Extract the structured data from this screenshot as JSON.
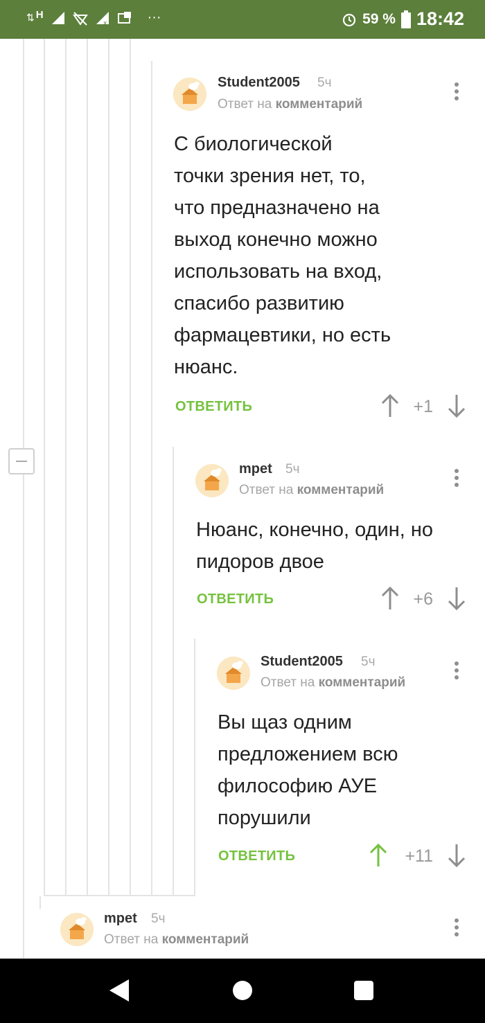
{
  "status_bar": {
    "network": "H",
    "battery_percent": "59 %",
    "time": "18:42",
    "more": "···"
  },
  "comments": [
    {
      "author": "Student2005",
      "time": "5ч",
      "reply_prefix": "Ответ на",
      "reply_link": "комментарий",
      "lines": [
        "С биологической",
        "точки зрения нет, то,",
        "что предназначено на",
        "выход конечно можно",
        "использовать на вход,",
        "спасибо развитию",
        "фармацевтики, но есть",
        "нюанс."
      ],
      "reply_label": "ОТВЕТИТЬ",
      "score": "+1",
      "upvoted": false
    },
    {
      "author": "mpet",
      "time": "5ч",
      "reply_prefix": "Ответ на",
      "reply_link": "комментарий",
      "lines": [
        "Нюанс, конечно, один, но",
        "пидоров двое"
      ],
      "reply_label": "ОТВЕТИТЬ",
      "score": "+6",
      "upvoted": false
    },
    {
      "author": "Student2005",
      "time": "5ч",
      "reply_prefix": "Ответ на",
      "reply_link": "комментарий",
      "lines": [
        "Вы щаз одним",
        "предложением всю",
        "философию АУЕ",
        "порушили"
      ],
      "reply_label": "ОТВЕТИТЬ",
      "score": "+11",
      "upvoted": true
    },
    {
      "author": "mpet",
      "time": "5ч",
      "reply_prefix": "Ответ на",
      "reply_link": "комментарий"
    }
  ],
  "colors": {
    "status_bar": "#5c7f3b",
    "reply_green": "#75c23e",
    "upvote_active": "#75c23e",
    "arrow_inactive": "#8e8e8e"
  }
}
